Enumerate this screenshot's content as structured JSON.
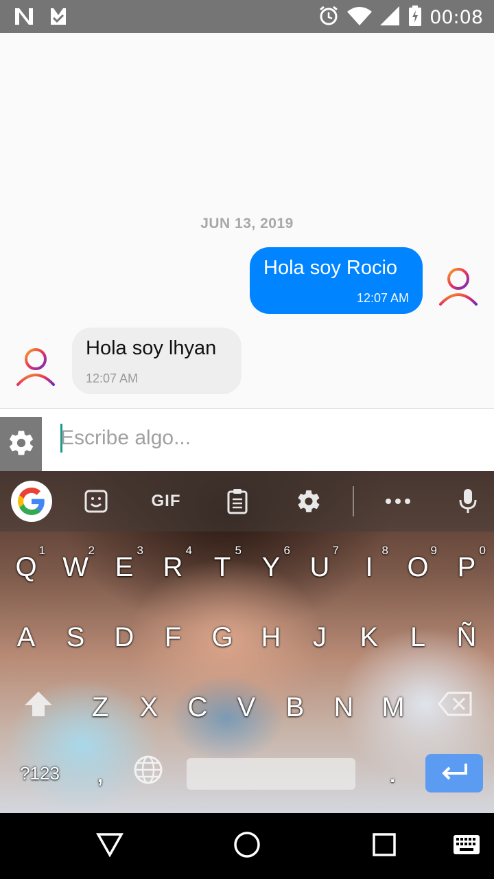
{
  "status_bar": {
    "time": "00:08",
    "icons": [
      "n-notification-icon",
      "download-check-icon",
      "alarm-icon",
      "wifi-icon",
      "signal-icon",
      "battery-charging-icon"
    ]
  },
  "chat": {
    "date_separator": "JUN 13, 2019",
    "messages": [
      {
        "direction": "outgoing",
        "text": "Hola soy Rocio",
        "time": "12:07 AM"
      },
      {
        "direction": "incoming",
        "text": "Hola soy lhyan",
        "time": "12:07 AM"
      }
    ],
    "colors": {
      "outgoing_bubble": "#0084ff",
      "incoming_bubble": "#eeeeee"
    }
  },
  "composer": {
    "placeholder": "Escribe algo...",
    "value": ""
  },
  "keyboard": {
    "toolbar": {
      "gif_label": "GIF",
      "items": [
        "google-icon",
        "sticker-icon",
        "gif",
        "clipboard-icon",
        "settings-icon",
        "more-icon",
        "microphone-icon"
      ]
    },
    "rows": [
      [
        {
          "key": "Q",
          "hint": "1"
        },
        {
          "key": "W",
          "hint": "2"
        },
        {
          "key": "E",
          "hint": "3"
        },
        {
          "key": "R",
          "hint": "4"
        },
        {
          "key": "T",
          "hint": "5"
        },
        {
          "key": "Y",
          "hint": "6"
        },
        {
          "key": "U",
          "hint": "7"
        },
        {
          "key": "I",
          "hint": "8"
        },
        {
          "key": "O",
          "hint": "9"
        },
        {
          "key": "P",
          "hint": "0"
        }
      ],
      [
        {
          "key": "A"
        },
        {
          "key": "S"
        },
        {
          "key": "D"
        },
        {
          "key": "F"
        },
        {
          "key": "G"
        },
        {
          "key": "H"
        },
        {
          "key": "J"
        },
        {
          "key": "K"
        },
        {
          "key": "L"
        },
        {
          "key": "Ñ"
        }
      ],
      [
        {
          "key": "Z"
        },
        {
          "key": "X"
        },
        {
          "key": "C"
        },
        {
          "key": "V"
        },
        {
          "key": "B"
        },
        {
          "key": "N"
        },
        {
          "key": "M"
        }
      ]
    ],
    "bottom_row": {
      "symbols_label": "?123",
      "comma_label": ",",
      "period_label": "."
    },
    "colors": {
      "enter_key": "#5b9cf2"
    }
  },
  "nav_bar": {
    "buttons": [
      "back-icon",
      "home-icon",
      "recents-icon",
      "keyboard-switch-icon"
    ]
  }
}
